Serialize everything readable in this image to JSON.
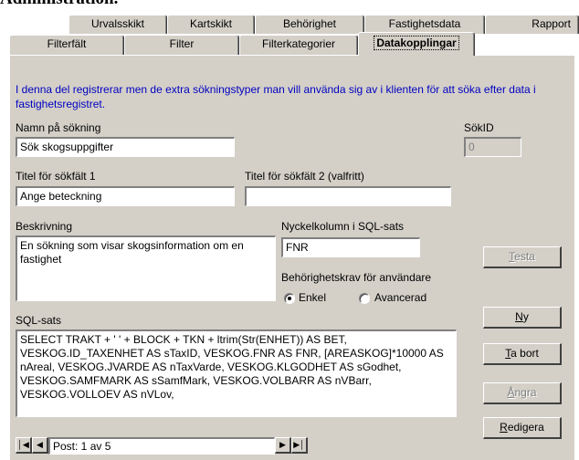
{
  "caption": "Administration.",
  "tabs_row1": [
    "Urvalsskikt",
    "Kartskikt",
    "Behörighet",
    "Fastighetsdata",
    "Rapport"
  ],
  "tabs_row2": [
    "Filterfält",
    "Filter",
    "Filterkategorier",
    "Datakopplingar"
  ],
  "active_tab": "Datakopplingar",
  "intro_text": "I denna del registrerar men de extra sökningstyper man vill använda sig av i klienten för att söka efter data i fastighetsregistret.",
  "form": {
    "search_name_label": "Namn på sökning",
    "search_name_value": "Sök skogsuppgifter",
    "sokid_label": "SökID",
    "sokid_value": "0",
    "field1_label": "Titel för sökfält 1",
    "field1_value": "Ange beteckning",
    "field2_label": "Titel för sökfält 2 (valfritt)",
    "field2_value": "",
    "description_label": "Beskrivning",
    "description_value": "En sökning som visar skogsinformation om en fastighet",
    "key_column_label": "Nyckelkolumn i SQL-sats",
    "key_column_value": "FNR",
    "permission_label": "Behörighetskrav för användare",
    "permission_option1": "Enkel",
    "permission_option2": "Avancerad",
    "sql_label": "SQL-sats",
    "sql_value": "SELECT TRAKT + ' ' + BLOCK + TKN + ltrim(Str(ENHET)) AS BET, VESKOG.ID_TAXENHET AS sTaxID, VESKOG.FNR AS FNR, [AREASKOG]*10000 AS nAreal, VESKOG.JVARDE AS nTaxVarde, VESKOG.KLGODHET AS sGodhet, VESKOG.SAMFMARK AS sSamfMark, VESKOG.VOLBARR AS nVBarr, VESKOG.VOLLOEV AS nVLov,"
  },
  "buttons": {
    "testa": {
      "hot": "T",
      "rest": "esta"
    },
    "ny": {
      "hot": "N",
      "rest": "y"
    },
    "ta_bort": {
      "hot": "T",
      "rest": "a bort"
    },
    "angra": {
      "hot": "Å",
      "rest": "ngra"
    },
    "redigera": {
      "hot": "R",
      "rest": "edigera"
    }
  },
  "navigator": {
    "record_text": "Post: 1 av 5"
  }
}
